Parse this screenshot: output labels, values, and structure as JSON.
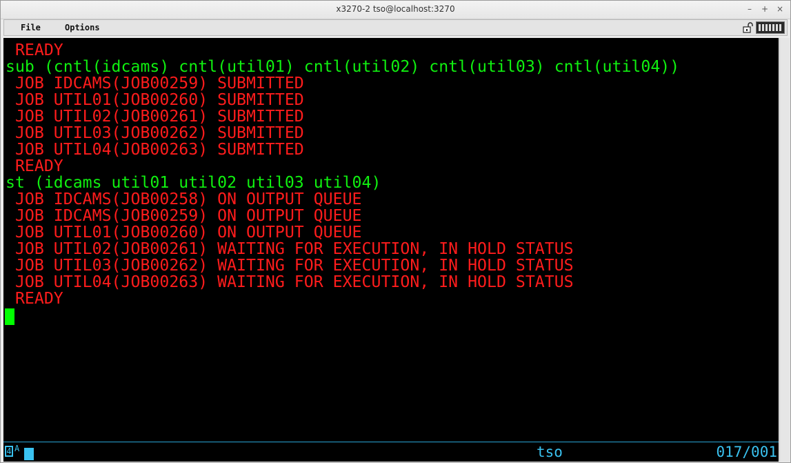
{
  "window": {
    "title": "x3270-2 tso@localhost:3270",
    "controls": {
      "minimize": "–",
      "maximize": "+",
      "close": "×"
    }
  },
  "menubar": {
    "file": "File",
    "options": "Options"
  },
  "terminal": {
    "colors": {
      "background": "#000000",
      "output": "#ff1c1c",
      "input": "#10f010",
      "cursor": "#00ff00",
      "status": "#3ac2f0"
    },
    "lines": [
      {
        "text": " READY",
        "color": "red"
      },
      {
        "text": "sub (cntl(idcams) cntl(util01) cntl(util02) cntl(util03) cntl(util04))",
        "color": "green"
      },
      {
        "text": " JOB IDCAMS(JOB00259) SUBMITTED",
        "color": "red"
      },
      {
        "text": " JOB UTIL01(JOB00260) SUBMITTED",
        "color": "red"
      },
      {
        "text": " JOB UTIL02(JOB00261) SUBMITTED",
        "color": "red"
      },
      {
        "text": " JOB UTIL03(JOB00262) SUBMITTED",
        "color": "red"
      },
      {
        "text": " JOB UTIL04(JOB00263) SUBMITTED",
        "color": "red"
      },
      {
        "text": " READY",
        "color": "red"
      },
      {
        "text": "st (idcams util01 util02 util03 util04)",
        "color": "green"
      },
      {
        "text": " JOB IDCAMS(JOB00258) ON OUTPUT QUEUE",
        "color": "red"
      },
      {
        "text": " JOB IDCAMS(JOB00259) ON OUTPUT QUEUE",
        "color": "red"
      },
      {
        "text": " JOB UTIL01(JOB00260) ON OUTPUT QUEUE",
        "color": "red"
      },
      {
        "text": " JOB UTIL02(JOB00261) WAITING FOR EXECUTION, IN HOLD STATUS",
        "color": "red"
      },
      {
        "text": " JOB UTIL03(JOB00262) WAITING FOR EXECUTION, IN HOLD STATUS",
        "color": "red"
      },
      {
        "text": " JOB UTIL04(JOB00263) WAITING FOR EXECUTION, IN HOLD STATUS",
        "color": "red"
      },
      {
        "text": " READY",
        "color": "red"
      }
    ]
  },
  "status_line": {
    "lu_indicator": "4",
    "connection_mark": "A",
    "user": "tso",
    "cursor_position": "017/001"
  },
  "icons": {
    "lock": "lock-icon",
    "keyboard": "keyboard-icon"
  }
}
